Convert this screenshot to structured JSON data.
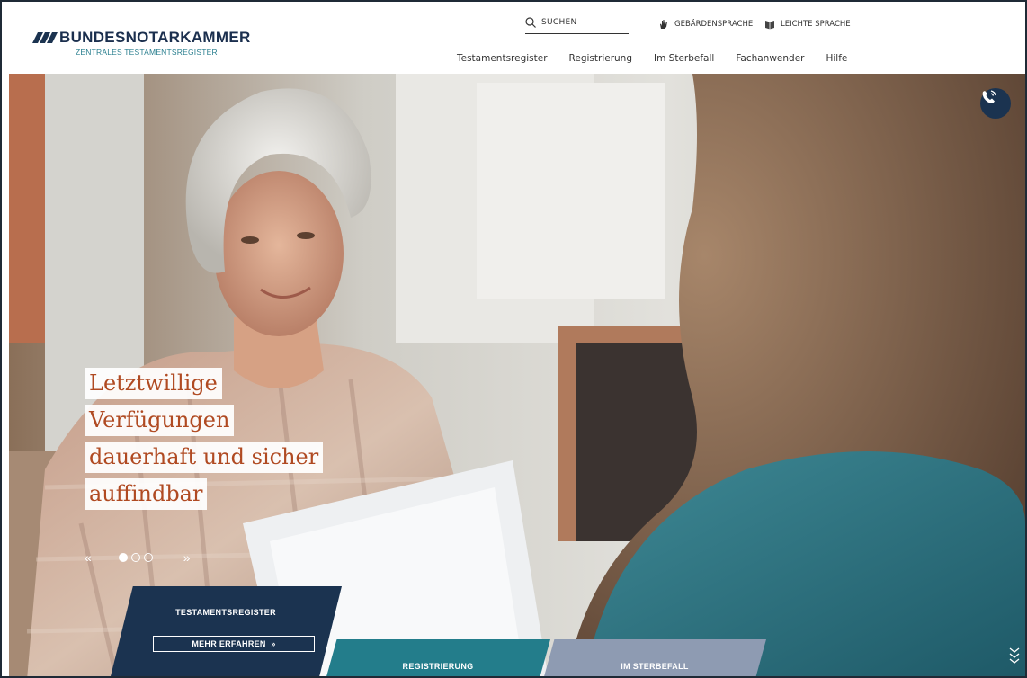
{
  "brand": {
    "title": "BUNDESNOTARKAMMER",
    "subtitle": "ZENTRALES TESTAMENTSREGISTER"
  },
  "utility": {
    "search_label": "SUCHEN",
    "sign_language": "GEBÄRDENSPRACHE",
    "easy_language": "LEICHTE SPRACHE"
  },
  "nav": {
    "items": [
      "Testamentsregister",
      "Registrierung",
      "Im Sterbefall",
      "Fachanwender",
      "Hilfe"
    ]
  },
  "hero": {
    "headline_lines": [
      "Letztwillige",
      "Verfügungen",
      "dauerhaft und sicher",
      "auffindbar"
    ],
    "slider": {
      "prev": "«",
      "next": "»",
      "total": 3,
      "active": 1
    }
  },
  "tiles": {
    "main_title": "TESTAMENTSREGISTER",
    "main_cta": "MEHR ERFAHREN",
    "registration": "REGISTRIERUNG",
    "death_case": "IM STERBEFALL"
  },
  "colors": {
    "navy": "#1b3350",
    "teal": "#237d8b",
    "slate": "#8e9bb2",
    "headline": "#b04a22"
  }
}
